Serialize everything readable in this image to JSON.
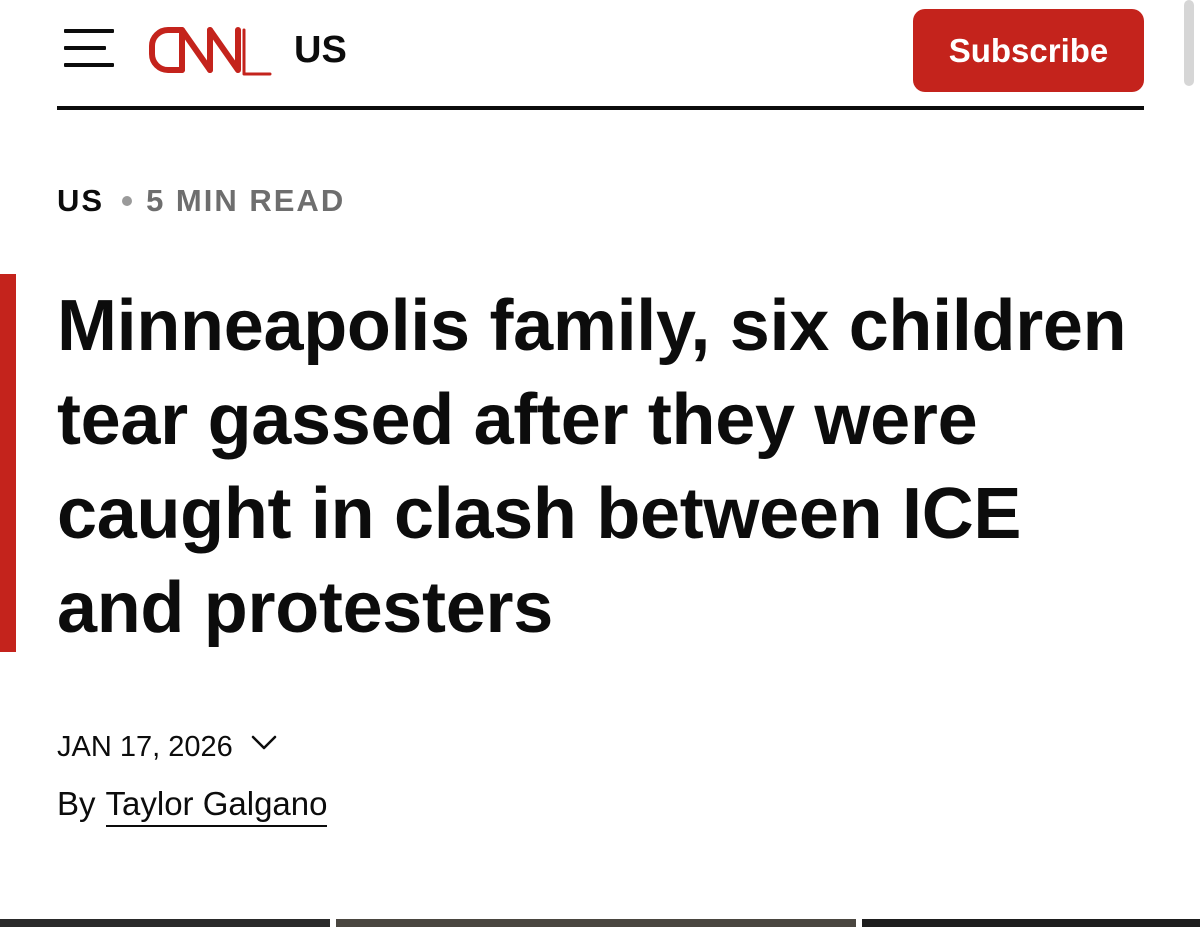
{
  "header": {
    "section": "US",
    "subscribe_label": "Subscribe",
    "brand_color": "#c4231c"
  },
  "meta": {
    "section": "US",
    "read_time": "5 MIN READ"
  },
  "article": {
    "headline": "Minneapolis family, six children tear gassed after they were caught in clash between ICE and protesters",
    "date": "JAN 17, 2026",
    "byline_prefix": "By",
    "author": "Taylor Galgano"
  },
  "icons": {
    "menu": "hamburger-menu-icon",
    "logo": "cnn-logo",
    "date_toggle": "chevron-down-icon"
  }
}
